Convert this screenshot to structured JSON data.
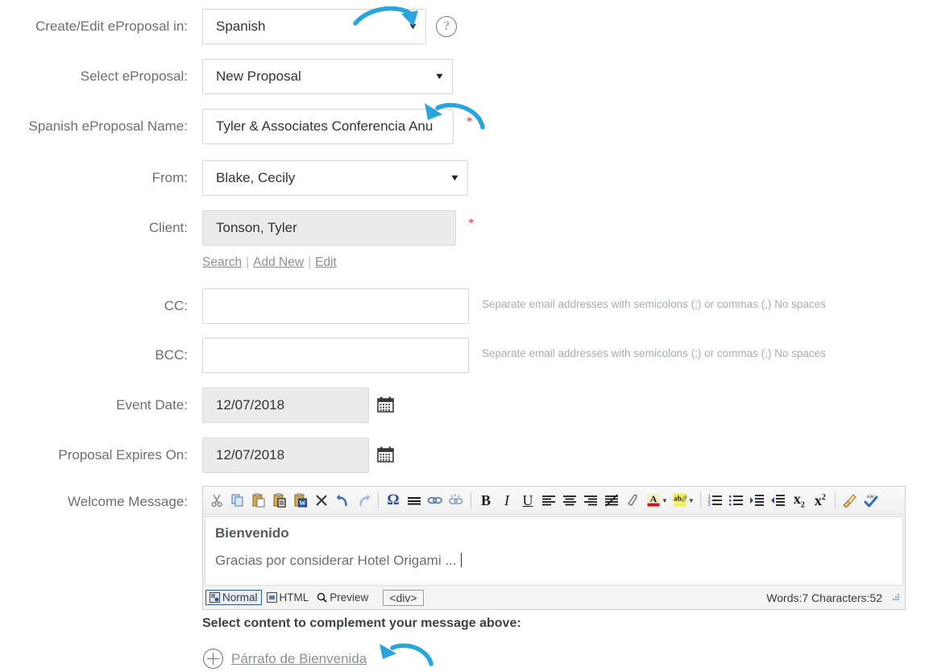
{
  "colors": {
    "annotation_blue": "#29a4dd",
    "required_red": "#e8252a",
    "label_gray": "#6d6e71",
    "hint_gray": "#a9abae",
    "link_gray": "#8d8f92"
  },
  "fields": {
    "language": {
      "label": "Create/Edit eProposal in:",
      "value": "Spanish",
      "help_icon": "question-mark-icon"
    },
    "proposal": {
      "label": "Select eProposal:",
      "value": "New Proposal"
    },
    "proposal_name": {
      "label": "Spanish eProposal Name:",
      "value": "Tyler & Associates Conferencia Anu",
      "required": "*"
    },
    "from": {
      "label": "From:",
      "value": "Blake, Cecily"
    },
    "client": {
      "label": "Client:",
      "value": "Tonson, Tyler",
      "required": "*",
      "actions": [
        {
          "label": "Search"
        },
        {
          "label": "Add New"
        },
        {
          "label": "Edit"
        }
      ],
      "separator": "|"
    },
    "cc": {
      "label": "CC:",
      "value": "",
      "hint": "Separate email addresses with semicolons (;) or commas (,) No spaces"
    },
    "bcc": {
      "label": "BCC:",
      "value": "",
      "hint": "Separate email addresses with semicolons (;) or commas (,) No spaces"
    },
    "event_date": {
      "label": "Event Date:",
      "value": "12/07/2018",
      "icon": "calendar-icon"
    },
    "expires_on": {
      "label": "Proposal Expires On:",
      "value": "12/07/2018",
      "icon": "calendar-icon"
    },
    "welcome_message": {
      "label": "Welcome Message:"
    }
  },
  "editor": {
    "toolbar": [
      {
        "name": "cut-icon",
        "glyph": "✂"
      },
      {
        "name": "copy-icon",
        "glyph": ""
      },
      {
        "name": "paste-icon",
        "glyph": ""
      },
      {
        "name": "paste-as-plain-text-icon",
        "glyph": ""
      },
      {
        "name": "paste-from-word-icon",
        "glyph": "W"
      },
      {
        "name": "remove-format-x-icon",
        "glyph": "✕"
      },
      {
        "name": "undo-icon",
        "glyph": "↶"
      },
      {
        "name": "redo-icon",
        "glyph": "↷"
      },
      {
        "name": "special-character-icon",
        "glyph": "Ω"
      },
      {
        "name": "horizontal-rule-icon",
        "glyph": "≡"
      },
      {
        "name": "link-icon",
        "glyph": "⚭"
      },
      {
        "name": "unlink-icon",
        "glyph": "⚭"
      },
      {
        "name": "bold-icon",
        "glyph": "B"
      },
      {
        "name": "italic-icon",
        "glyph": "I"
      },
      {
        "name": "underline-icon",
        "glyph": "U"
      },
      {
        "name": "align-left-icon",
        "glyph": ""
      },
      {
        "name": "align-center-icon",
        "glyph": ""
      },
      {
        "name": "align-right-icon",
        "glyph": ""
      },
      {
        "name": "align-justify-icon",
        "glyph": ""
      },
      {
        "name": "eraser-icon",
        "glyph": ""
      },
      {
        "name": "text-color-icon",
        "glyph": "A"
      },
      {
        "name": "text-color-dropdown-icon",
        "glyph": "▾"
      },
      {
        "name": "highlight-color-icon",
        "glyph": "ab"
      },
      {
        "name": "highlight-color-dropdown-icon",
        "glyph": "▾"
      },
      {
        "name": "numbered-list-icon",
        "glyph": ""
      },
      {
        "name": "bulleted-list-icon",
        "glyph": ""
      },
      {
        "name": "increase-indent-icon",
        "glyph": ""
      },
      {
        "name": "decrease-indent-icon",
        "glyph": ""
      },
      {
        "name": "subscript-icon",
        "glyph": "x"
      },
      {
        "name": "superscript-icon",
        "glyph": "x"
      },
      {
        "name": "format-painter-icon",
        "glyph": ""
      },
      {
        "name": "spellcheck-icon",
        "glyph": "✔"
      }
    ],
    "content": {
      "title": "Bienvenido",
      "body": "Gracias por considerar Hotel Origami ..."
    },
    "modes": [
      {
        "label": "Normal",
        "icon": "normal-view-icon",
        "active": true
      },
      {
        "label": "HTML",
        "icon": "html-view-icon",
        "active": false
      },
      {
        "label": "Preview",
        "icon": "preview-magnifier-icon",
        "active": false
      }
    ],
    "element_path": "<div>",
    "word_count": "Words:7 Characters:52",
    "resize_grip": "resize-grip-icon"
  },
  "content_section": {
    "title": "Select content to complement your message above:",
    "items": [
      {
        "label": "Párrafo de Bienvenida",
        "icon": "plus-circle-icon"
      }
    ]
  },
  "annotations": [
    {
      "name": "arrow-to-language-dropdown",
      "direction": "right-down"
    },
    {
      "name": "arrow-to-proposal-name-field",
      "direction": "left-up"
    },
    {
      "name": "arrow-to-parrafo-de-bienvenida-link",
      "direction": "left-up"
    }
  ]
}
